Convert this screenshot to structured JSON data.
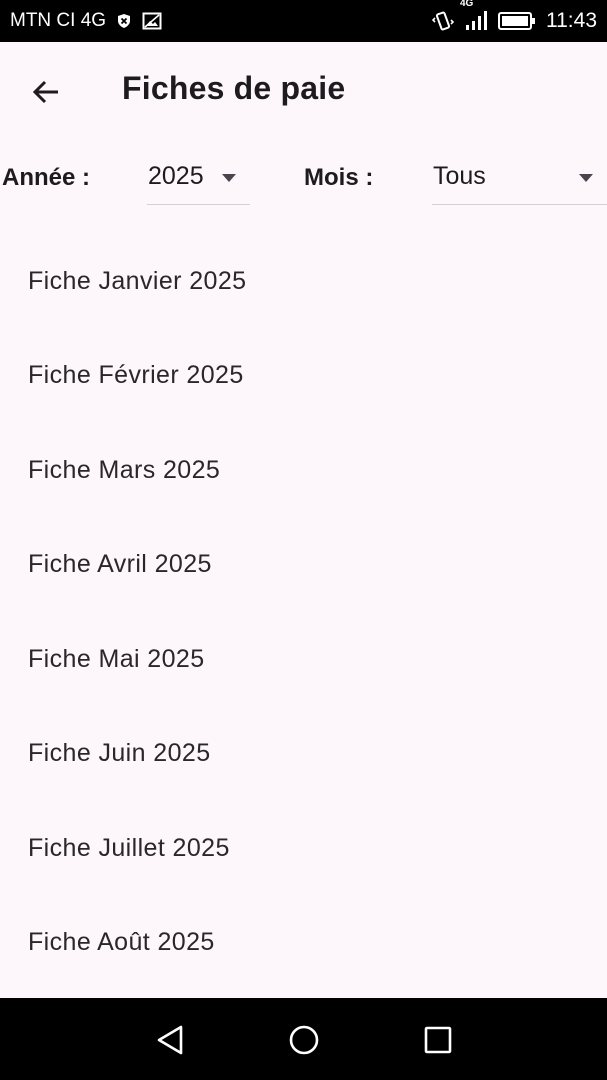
{
  "status_bar": {
    "carrier": "MTN CI 4G",
    "network_badge": "4G",
    "time": "11:43",
    "icons": [
      "blocked-icon",
      "image-icon",
      "vibrate-icon",
      "signal-icon",
      "battery-icon"
    ]
  },
  "appbar": {
    "title": "Fiches de paie",
    "back_icon": "arrow-left-icon"
  },
  "filters": {
    "year_label": "Année :",
    "year_value": "2025",
    "month_label": "Mois :",
    "month_value": "Tous"
  },
  "payslips": [
    {
      "label": "Fiche Janvier 2025"
    },
    {
      "label": "Fiche Février 2025"
    },
    {
      "label": "Fiche Mars 2025"
    },
    {
      "label": "Fiche Avril 2025"
    },
    {
      "label": "Fiche Mai 2025"
    },
    {
      "label": "Fiche Juin 2025"
    },
    {
      "label": "Fiche Juillet 2025"
    },
    {
      "label": "Fiche Août 2025"
    }
  ],
  "navbar": {
    "icons": [
      "nav-back-icon",
      "nav-home-icon",
      "nav-recents-icon"
    ]
  },
  "colors": {
    "background": "#fdf7fb",
    "text": "#1d1b20",
    "bars": "#000000"
  }
}
